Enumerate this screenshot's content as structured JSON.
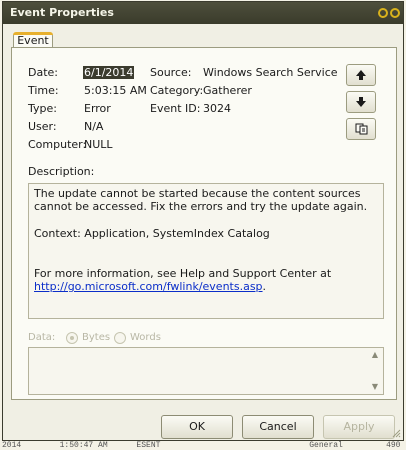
{
  "window": {
    "title": "Event Properties"
  },
  "tabs": [
    {
      "label": "Event"
    }
  ],
  "event": {
    "date_label": "Date:",
    "date": "6/1/2014",
    "time_label": "Time:",
    "time": "5:03:15 AM",
    "type_label": "Type:",
    "type": "Error",
    "user_label": "User:",
    "user": "N/A",
    "computer_label": "Computer:",
    "computer": "NULL",
    "source_label": "Source:",
    "source": "Windows Search Service",
    "category_label": "Category:",
    "category": "Gatherer",
    "event_id_label": "Event ID:",
    "event_id": "3024"
  },
  "nav": {
    "up_icon": "arrow-up-icon",
    "down_icon": "arrow-down-icon",
    "copy_icon": "copy-icon"
  },
  "description": {
    "label": "Description:",
    "line1": "The update cannot be started because the content sources cannot be accessed. Fix the errors and try the update again.",
    "line2": "Context:  Application, SystemIndex Catalog",
    "line3": "For more information, see Help and Support Center at",
    "link": "http://go.microsoft.com/fwlink/events.asp",
    "link_suffix": "."
  },
  "data_section": {
    "label": "Data:",
    "bytes_label": "Bytes",
    "words_label": "Words"
  },
  "buttons": {
    "ok": "OK",
    "cancel": "Cancel",
    "apply": "Apply"
  },
  "background": {
    "bottom_row": "2014        1:50:47 AM      ESENT                               General         490"
  },
  "colors": {
    "titlebar": "#3a3b2b",
    "accent": "#e7b02e",
    "link": "#0b2ec9"
  }
}
